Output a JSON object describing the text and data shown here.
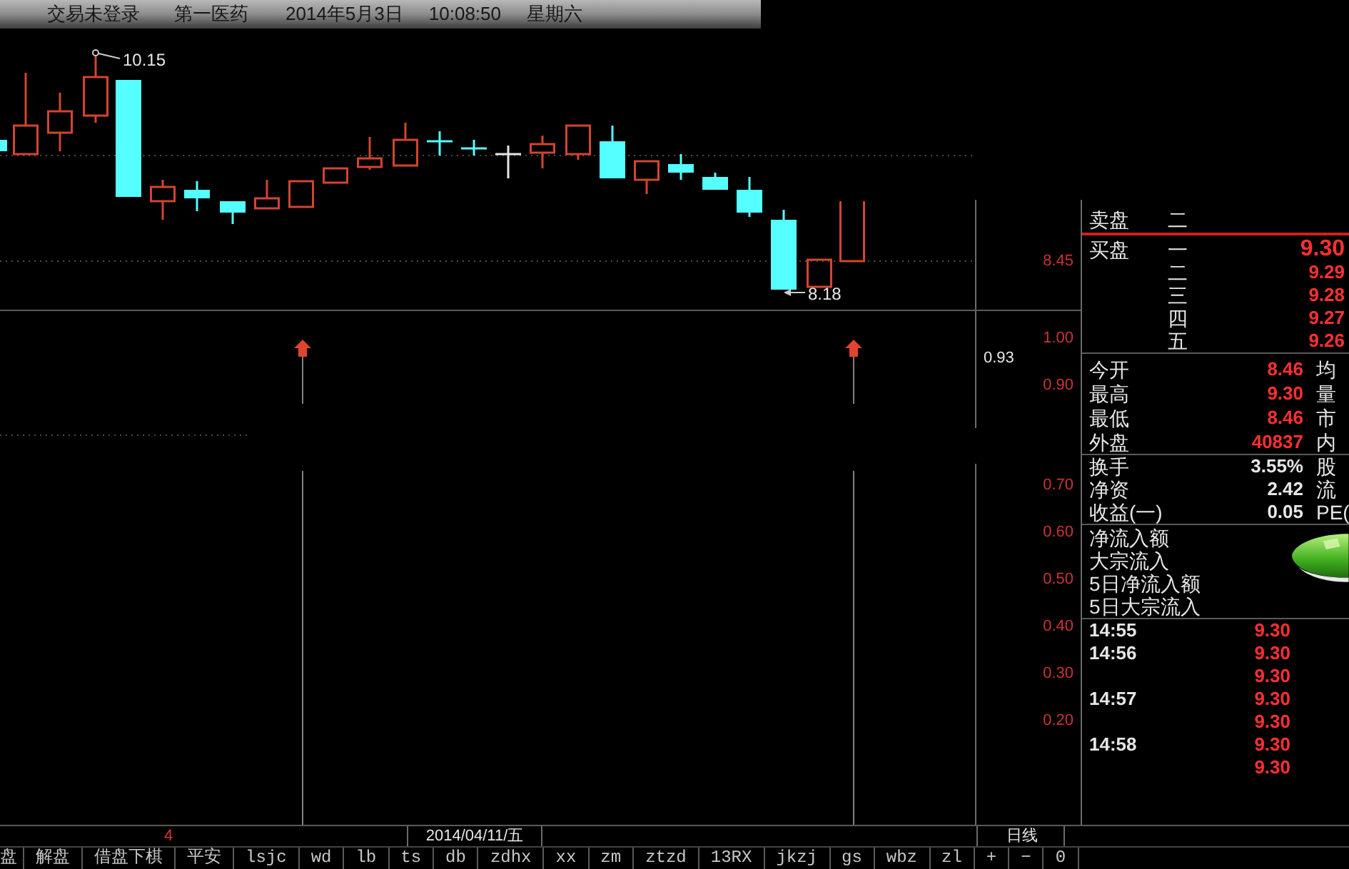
{
  "title_bar": {
    "trade_status": "交易未登录",
    "stock_name": "第一医药",
    "date": "2014年5月3日",
    "time": "10:08:50",
    "weekday": "星期六"
  },
  "price_chart": {
    "high_label": "10.15",
    "low_label": "8.18",
    "axis_labels": [
      "8.45"
    ]
  },
  "indicator_panel": {
    "axis_labels": [
      {
        "kind": "tick",
        "text": "1.00"
      },
      {
        "kind": "current",
        "text": "0.93"
      },
      {
        "kind": "tick",
        "text": "0.90"
      }
    ]
  },
  "lower_panel": {
    "axis_labels": [
      "0.70",
      "0.60",
      "0.50",
      "0.40",
      "0.30",
      "0.20"
    ]
  },
  "quote_panel": {
    "sell_label": "卖盘",
    "sell_rows": [
      {
        "rank": "二"
      }
    ],
    "buy_label": "买盘",
    "buy_rows": [
      {
        "rank": "一",
        "price": "9.30"
      },
      {
        "rank": "二",
        "price": "9.29"
      },
      {
        "rank": "三",
        "price": "9.28"
      },
      {
        "rank": "四",
        "price": "9.27"
      },
      {
        "rank": "五",
        "price": "9.26"
      }
    ],
    "stats": [
      {
        "label": "今开",
        "value": "8.46",
        "right_label": "均"
      },
      {
        "label": "最高",
        "value": "9.30",
        "right_label": "量"
      },
      {
        "label": "最低",
        "value": "8.46",
        "right_label": "市"
      },
      {
        "label": "外盘",
        "value": "40837",
        "right_label": "内"
      }
    ],
    "ratios": [
      {
        "label": "换手",
        "value": "3.55%",
        "right_label": "股"
      },
      {
        "label": "净资",
        "value": "2.42",
        "right_label": "流"
      },
      {
        "label": "收益(一)",
        "value": "0.05",
        "right_label": "PE("
      }
    ],
    "fund_flow": [
      "净流入额",
      "大宗流入",
      "5日净流入额",
      "5日大宗流入"
    ],
    "ticks": [
      {
        "time": "14:55",
        "price": "9.30"
      },
      {
        "time": "14:56",
        "price": "9.30"
      },
      {
        "price": "9.30"
      },
      {
        "time": "14:57",
        "price": "9.30"
      },
      {
        "price": "9.30"
      },
      {
        "time": "14:58",
        "price": "9.30"
      },
      {
        "price": "9.30"
      }
    ]
  },
  "date_bar": {
    "marker": "4",
    "date": "2014/04/11/五",
    "period": "日线"
  },
  "tabs": [
    "盘",
    "解盘",
    "借盘下棋",
    "平安",
    "lsjc",
    "wd",
    "lb",
    "ts",
    "db",
    "zdhx",
    "xx",
    "zm",
    "ztzd",
    "13RX",
    "jkzj",
    "gs",
    "wbz",
    "zl",
    "+",
    "−",
    "0"
  ]
}
